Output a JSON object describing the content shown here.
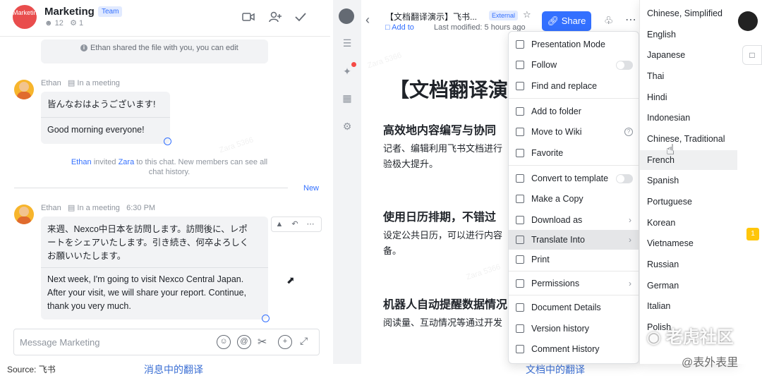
{
  "chat": {
    "avatar_text": "Marketing",
    "title": "Marketing",
    "badge": "Team",
    "members": "12",
    "bots": "1",
    "system_message": "Ethan shared the file with you, you can edit",
    "messages": [
      {
        "sender": "Ethan",
        "status": "In a meeting",
        "time": "",
        "lines": [
          "皆んなおはようございます!",
          "Good morning everyone!"
        ]
      },
      {
        "sender": "Ethan",
        "status": "In a meeting",
        "time": "6:30 PM",
        "lines": [
          "来週、Nexco中日本を訪問します。訪問後に、レポ",
          "ートをシェアいたします。引き続き、何卒よろしく",
          "お願いいたします。",
          "Next week, I'm going to visit Nexco Central Japan.",
          "After your visit, we will share your report. Continue,",
          "thank you very much."
        ]
      }
    ],
    "invite_notice": {
      "inviter": "Ethan",
      "invitee": "Zara",
      "text_mid": "invited",
      "text_end": "to this chat. New members can see all",
      "text_line2": "chat history."
    },
    "new_label": "New",
    "input_placeholder": "Message Marketing"
  },
  "captions": {
    "source": "Source: 飞书",
    "left": "消息中的翻译",
    "right": "文档中的翻译"
  },
  "doc": {
    "title": "【文档翻译演示】飞书...",
    "external_badge": "External",
    "add_to": "Add to",
    "last_modified": "Last modified: 5 hours ago",
    "share_label": "Share",
    "heading": "【文档翻译演",
    "sections": [
      {
        "h": "高效地内容编写与协同",
        "p": [
          "记者、编辑利用飞书文档进行",
          "验极大提升。"
        ]
      },
      {
        "h": "使用日历排期，不错过",
        "p": [
          "设定公共日历，可以进行内容",
          "备。"
        ]
      },
      {
        "h": "机器人自动提醒数据情况",
        "p": [
          "阅读量、互动情况等通过开发"
        ]
      }
    ]
  },
  "menu": {
    "items": [
      {
        "label": "Presentation Mode"
      },
      {
        "label": "Follow",
        "toggle": true
      },
      {
        "label": "Find and replace"
      },
      {
        "label": "Add to folder"
      },
      {
        "label": "Move to Wiki",
        "help": "?"
      },
      {
        "label": "Favorite"
      },
      {
        "label": "Convert to template",
        "toggle": true
      },
      {
        "label": "Make a Copy"
      },
      {
        "label": "Download as",
        "chevron": "›"
      },
      {
        "label": "Translate Into",
        "chevron": "›",
        "active": true
      },
      {
        "label": "Print"
      },
      {
        "label": "Permissions",
        "chevron": "›"
      },
      {
        "label": "Document Details"
      },
      {
        "label": "Version history"
      },
      {
        "label": "Comment History"
      }
    ]
  },
  "languages": [
    "Chinese, Simplified",
    "English",
    "Japanese",
    "Thai",
    "Hindi",
    "Indonesian",
    "Chinese, Traditional",
    "French",
    "Spanish",
    "Portuguese",
    "Korean",
    "Vietnamese",
    "Russian",
    "German",
    "Italian",
    "Polish"
  ],
  "hover_language": "French",
  "watermark": "Zara 5366",
  "brand": {
    "main": "老虎社区",
    "sub": "@表外表里"
  },
  "note_count": "1",
  "colors": {
    "accent": "#3370ff",
    "group_avatar": "#e94d4d",
    "note": "#ffc60a"
  }
}
